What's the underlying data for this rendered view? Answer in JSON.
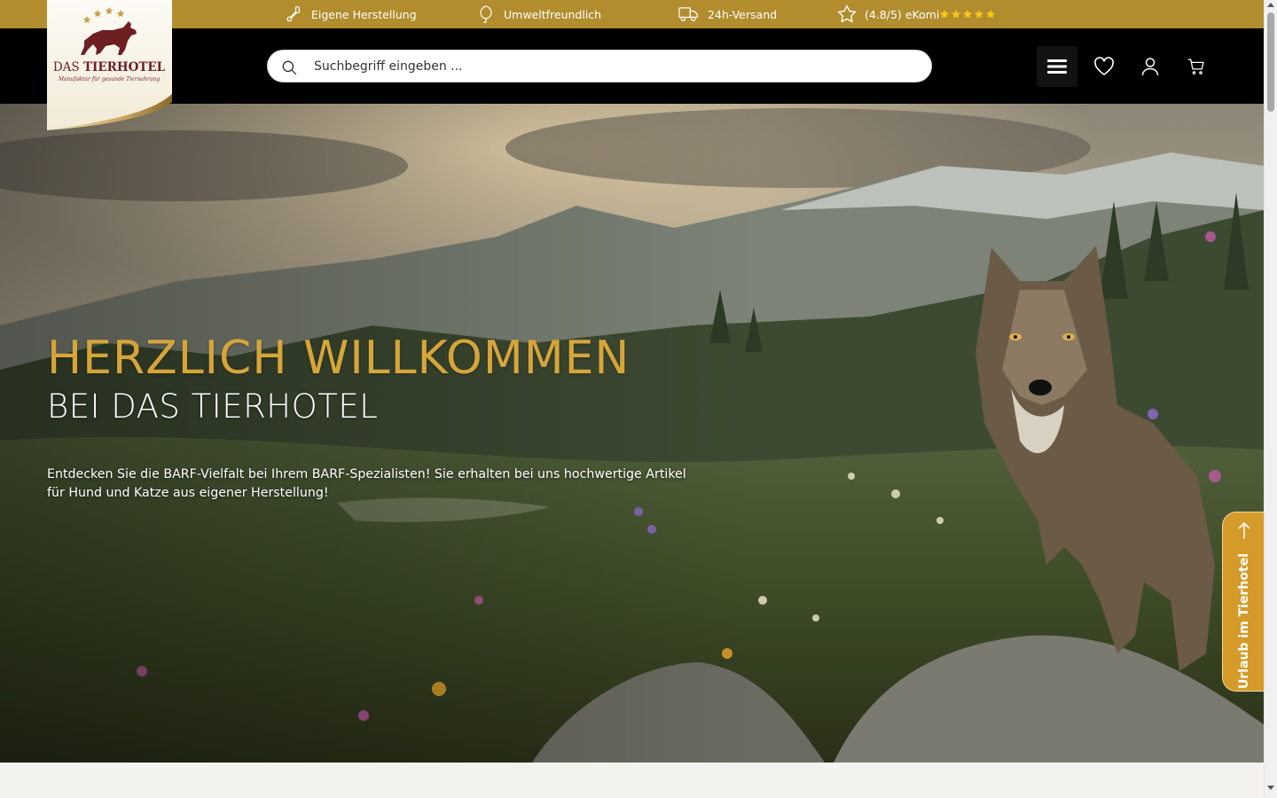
{
  "topbar": {
    "usp_manufacturing": "Eigene Herstellung",
    "usp_eco": "Umweltfreundlich",
    "usp_shipping": "24h-Versand",
    "rating_text": "(4.8/5) eKomi",
    "rating_value": 4.8,
    "rating_max": 5,
    "star_color": "#f5c518",
    "background": "#b28d2e"
  },
  "header": {
    "search_placeholder": "Suchbegriff eingeben ...",
    "icons": [
      "search-icon",
      "menu-icon",
      "heart-icon",
      "user-icon",
      "cart-icon"
    ]
  },
  "logo": {
    "name": "DAS TIERHOTEL",
    "tagline": "Manufaktur für gesunde Tiernahrung"
  },
  "hero": {
    "title": "HERZLICH WILLKOMMEN",
    "subtitle": "BEI DAS TIERHOTEL",
    "text": "Entdecken Sie die BARF-Vielfalt bei Ihrem BARF-Spezialisten! Sie erhalten bei uns hochwertige Artikel für Hund und Katze aus eigener Herstellung!",
    "accent_color": "#d6a53a"
  },
  "side_tab": {
    "label": "Urlaub im Tierhotel",
    "color": "#d59b2a"
  }
}
